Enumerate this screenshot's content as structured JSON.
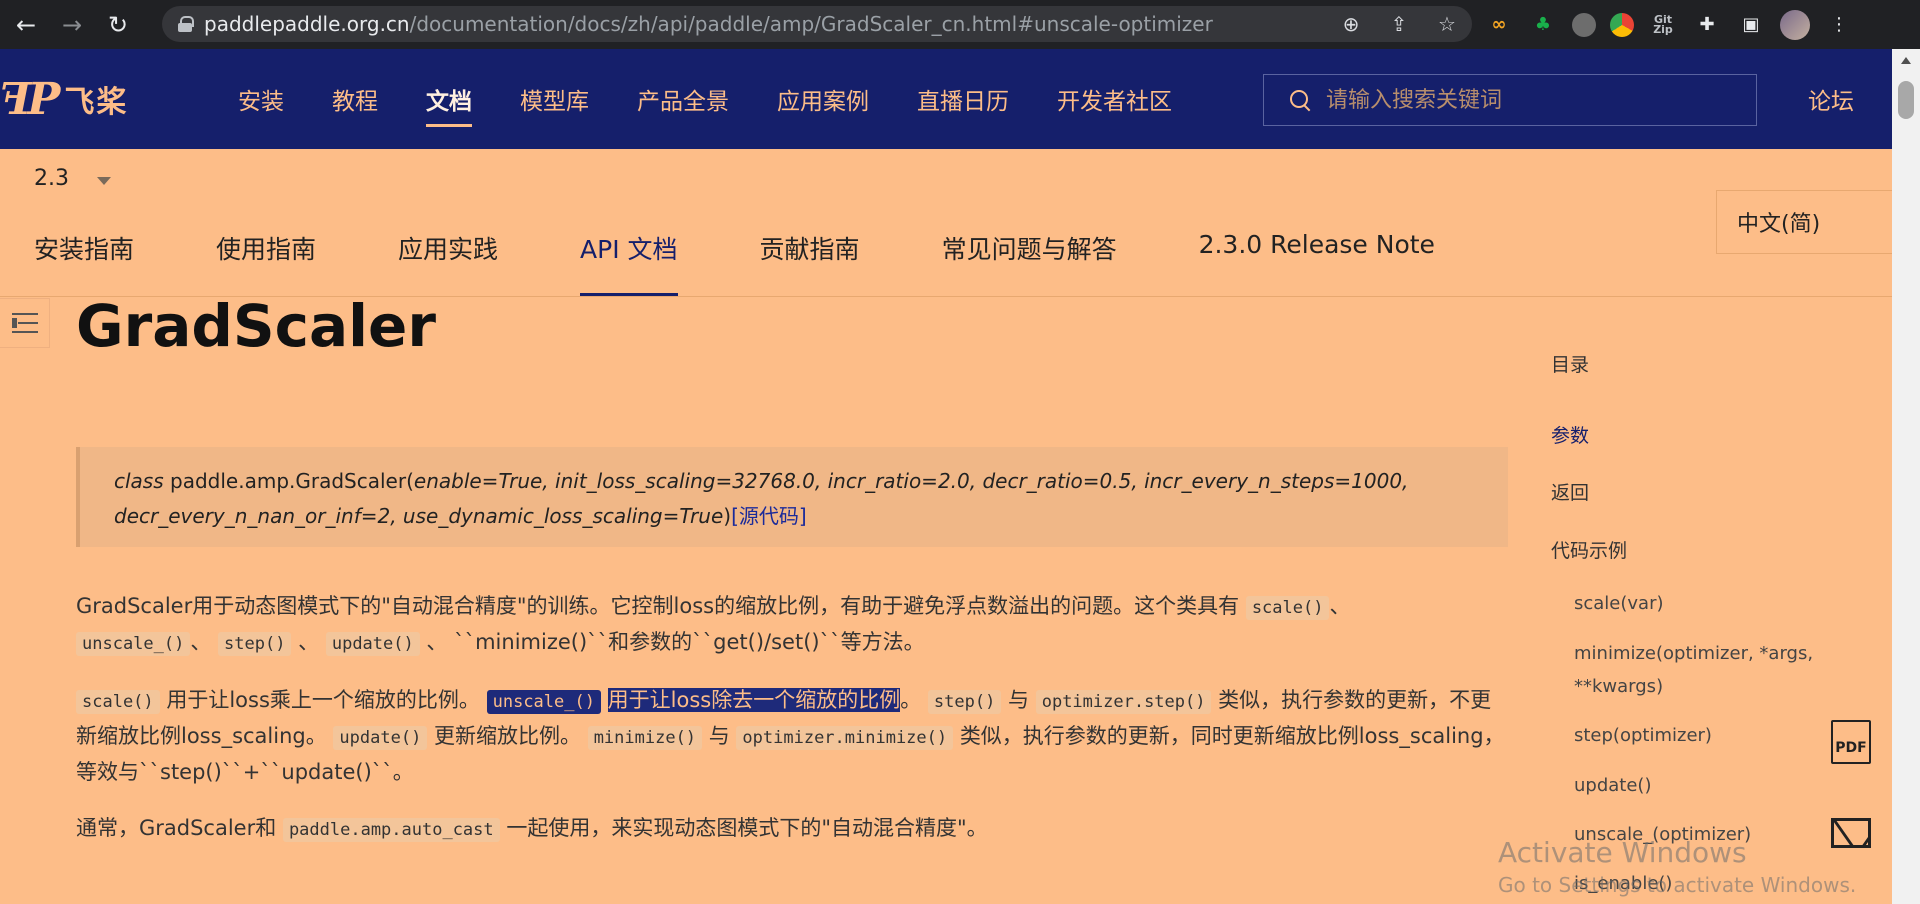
{
  "browser": {
    "url_host": "paddlepaddle.org.cn",
    "url_path": "/documentation/docs/zh/api/paddle/amp/GradScaler_cn.html#unscale-optimizer",
    "back_icon": "←",
    "forward_icon": "→",
    "reload_icon": "↻",
    "zoom_icon": "⊕",
    "share_icon": "⇪",
    "star_icon": "☆",
    "puzzle_icon": "✚",
    "sidepanel_icon": "▣",
    "menu_icon": "⋮",
    "ext_infinity": "∞",
    "ext_leaf": "♣",
    "ext_zip": "Git Zip"
  },
  "header": {
    "logo_mark": "ꟻP",
    "logo_text": "飞桨",
    "nav": [
      "安装",
      "教程",
      "文档",
      "模型库",
      "产品全景",
      "应用案例",
      "直播日历",
      "开发者社区"
    ],
    "search_placeholder": "请输入搜索关键词",
    "forum": "论坛"
  },
  "version": "2.3",
  "language": "中文(简)",
  "subnav": [
    "安装指南",
    "使用指南",
    "应用实践",
    "API 文档",
    "贡献指南",
    "常见问题与解答",
    "2.3.0 Release Note"
  ],
  "title": "GradScaler",
  "signature": {
    "kw": "class",
    "name": "paddle.amp.GradScaler",
    "params_line1": "enable=True, init_loss_scaling=32768.0, incr_ratio=2.0, decr_ratio=0.5, incr_every_n_steps=1000,",
    "params_line2": "decr_every_n_nan_or_inf=2, use_dynamic_loss_scaling=True",
    "source_link": "[源代码]"
  },
  "para1": {
    "t1": "GradScaler用于动态图模式下的\"自动混合精度\"的训练。它控制loss的缩放比例，有助于避免浮点数溢出的问题。这个类具有",
    "c1": "scale()",
    "t2": "、",
    "c2": "unscale_()",
    "t3": "、",
    "c3": "step()",
    "t4": "、",
    "c4": "update()",
    "t5": "、 ``minimize()``和参数的``get()/set()``等方法。"
  },
  "para2": {
    "c1": "scale()",
    "t1": "用于让loss乘上一个缩放的比例。",
    "c2": "unscale_()",
    "t2": "用于让loss除去一个缩放的比例",
    "t3": "。",
    "c3": "step()",
    "t4": "与",
    "c4": "optimizer.step()",
    "t5": "类似，执行参数的更新，不更新缩放比例loss_scaling。",
    "c5": "update()",
    "t6": "更新缩放比例。",
    "c6": "minimize()",
    "t7": "与",
    "c7": "optimizer.minimize()",
    "t8": "类似，执行参数的更新，同时更新缩放比例loss_scaling，等效与``step()``+``update()``。"
  },
  "para3": {
    "t1": "通常，GradScaler和",
    "c1": "paddle.amp.auto_cast",
    "t2": "一起使用，来实现动态图模式下的\"自动混合精度\"。"
  },
  "toc": {
    "title": "目录",
    "items": [
      "参数",
      "返回",
      "代码示例"
    ],
    "subitems": [
      "scale(var)",
      "minimize(optimizer, *args,",
      "**kwargs)",
      "step(optimizer)",
      "update()",
      "unscale_(optimizer)",
      "is_enable()"
    ]
  },
  "floating": {
    "pdf_label": "PDF"
  },
  "watermark": {
    "line1": "Activate Windows",
    "line2": "Go to Settings to activate Windows."
  }
}
